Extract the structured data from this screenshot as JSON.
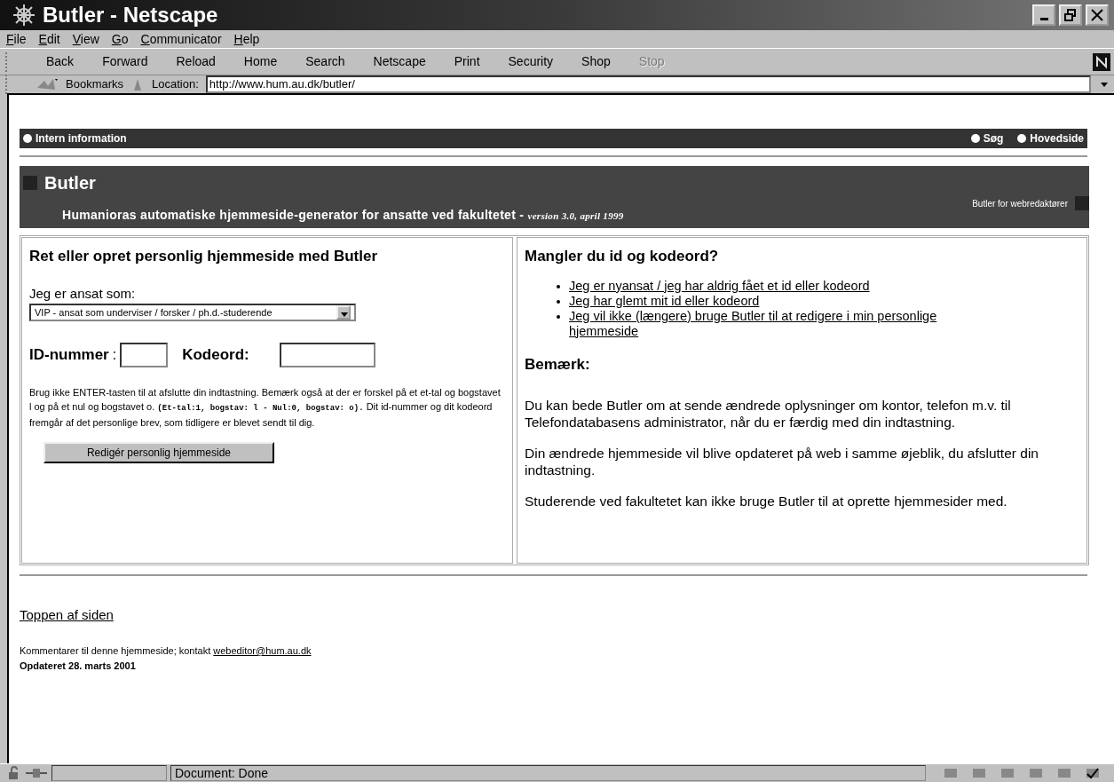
{
  "window": {
    "title": "Butler - Netscape"
  },
  "menu": [
    "File",
    "Edit",
    "View",
    "Go",
    "Communicator",
    "Help"
  ],
  "toolbar": [
    {
      "label": "Back",
      "disabled": false
    },
    {
      "label": "Forward",
      "disabled": false
    },
    {
      "label": "Reload",
      "disabled": false
    },
    {
      "label": "Home",
      "disabled": false
    },
    {
      "label": "Search",
      "disabled": false
    },
    {
      "label": "Netscape",
      "disabled": false
    },
    {
      "label": "Print",
      "disabled": false
    },
    {
      "label": "Security",
      "disabled": false
    },
    {
      "label": "Shop",
      "disabled": false
    },
    {
      "label": "Stop",
      "disabled": true
    }
  ],
  "location_bar": {
    "bookmarks": "Bookmarks",
    "label": "Location:",
    "url": "http://www.hum.au.dk/butler/"
  },
  "top_nav": {
    "left": [
      "Intern information"
    ],
    "right": [
      "Søg",
      "Hovedside"
    ]
  },
  "header": {
    "title": "Butler",
    "subtitle": "Humanioras automatiske hjemmeside-generator for ansatte ved fakultetet - ",
    "version": "version 3.0,  april 1999",
    "side_link": "Butler for webredaktører"
  },
  "left_panel": {
    "heading": "Ret eller opret personlig hjemmeside med Butler",
    "select_label": "Jeg er ansat som:",
    "select_value": "VIP - ansat som underviser / forsker / ph.d.-studerende",
    "id_label": "ID-nummer",
    "id_sep": ":",
    "password_label": "Kodeord:",
    "note": {
      "before": "Brug ikke ENTER-tasten til at afslutte din indtastning. Bemærk også at der er forskel på et et-tal og bogstavet l og på et nul og bogstavet o.",
      "code": "(Et-tal:1, bogstav: l - Nul:0, bogstav: o).",
      "after": "Dit id-nummer og dit kodeord fremgår af det personlige brev, som tidligere er blevet sendt til dig."
    },
    "button": "Redigér personlig hjemmeside"
  },
  "right_panel": {
    "heading": "Mangler du id og kodeord?",
    "links": [
      "Jeg er nyansat / jeg har aldrig fået et id eller kodeord",
      "Jeg har glemt mit id eller kodeord",
      "Jeg vil ikke (længere) bruge Butler til at redigere i min personlige hjemmeside"
    ],
    "note_heading": "Bemærk:",
    "paragraphs": [
      "Du kan bede Butler om at sende ændrede oplysninger om kontor, telefon m.v. til Telefondatabasens administrator, når du er færdig med din indtastning.",
      "Din ændrede hjemmeside vil blive opdateret på web i samme øjeblik, du afslutter din indtastning.",
      "Studerende ved fakultetet kan ikke bruge Butler til at oprette hjemmesider med."
    ]
  },
  "footer": {
    "top_link": "Toppen af siden",
    "comment": "Kommentarer til denne hjemmeside; kontakt ",
    "email": "webeditor@hum.au.dk",
    "updated": "Opdateret 28. marts 2001"
  },
  "status_bar": {
    "text": "Document: Done"
  }
}
